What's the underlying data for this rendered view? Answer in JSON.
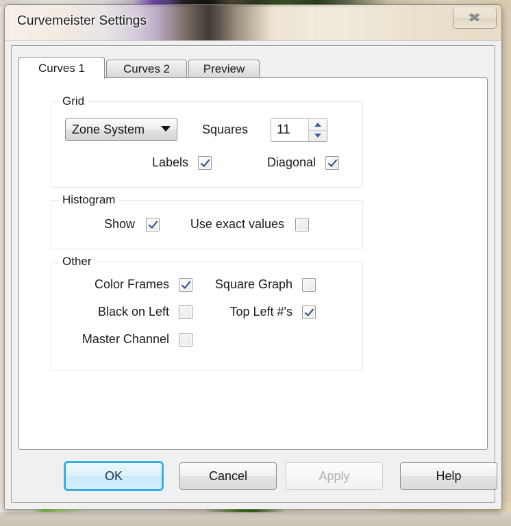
{
  "window": {
    "title": "Curvemeister Settings",
    "close_icon": "close-x-icon",
    "close_label": "✖"
  },
  "tabs": [
    {
      "label": "Curves 1",
      "active": true
    },
    {
      "label": "Curves 2",
      "active": false
    },
    {
      "label": "Preview",
      "active": false
    }
  ],
  "groups": {
    "grid": {
      "legend": "Grid",
      "select": {
        "value": "Zone System",
        "arrow_icon": "chevron-down-icon"
      },
      "squares": {
        "label": "Squares",
        "value": "11",
        "up_icon": "spinner-up-icon",
        "down_icon": "spinner-down-icon"
      },
      "checkboxes": [
        {
          "label": "Labels",
          "checked": true
        },
        {
          "label": "Diagonal",
          "checked": true
        }
      ]
    },
    "histogram": {
      "legend": "Histogram",
      "checkboxes": [
        {
          "label": "Show",
          "checked": true
        },
        {
          "label": "Use exact values",
          "checked": false
        }
      ]
    },
    "other": {
      "legend": "Other",
      "checkboxes": [
        {
          "label": "Color Frames",
          "checked": true
        },
        {
          "label": "Square Graph",
          "checked": false
        },
        {
          "label": "Black on Left",
          "checked": false
        },
        {
          "label": "Top Left #'s",
          "checked": true
        },
        {
          "label": "Master Channel",
          "checked": false
        }
      ]
    }
  },
  "buttons": [
    {
      "label": "OK",
      "state": "primary"
    },
    {
      "label": "Cancel",
      "state": "normal"
    },
    {
      "label": "Apply",
      "state": "disabled"
    },
    {
      "label": "Help",
      "state": "normal"
    }
  ],
  "colors": {
    "accent": "#3cb4e8",
    "checkmark": "#2b4a85",
    "dialog_background": "#f0f0f0",
    "panel_background": "#ffffff",
    "group_border": "#e3e6ea"
  }
}
